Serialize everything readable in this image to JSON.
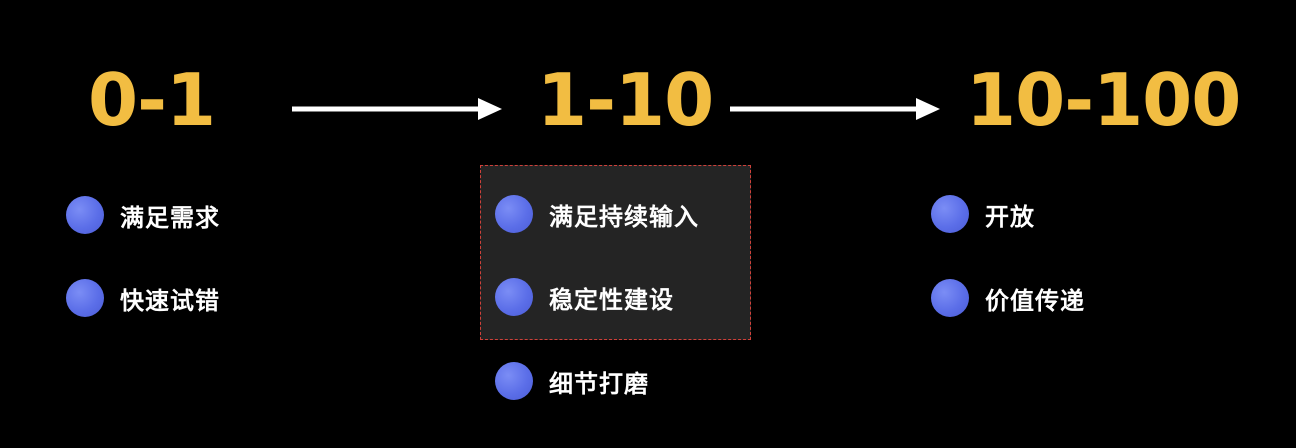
{
  "stages": [
    {
      "label": "0-1",
      "items": [
        "满足需求",
        "快速试错"
      ]
    },
    {
      "label": "1-10",
      "items": [
        "满足持续输入",
        "稳定性建设",
        "细节打磨"
      ]
    },
    {
      "label": "10-100",
      "items": [
        "开放",
        "价值传递"
      ]
    }
  ],
  "colors": {
    "background": "#000000",
    "stage_title": "#f2bd42",
    "bullet": "#5b6ee8",
    "highlight_border": "#d0413a",
    "highlight_fill": "#242424",
    "arrow": "#ffffff"
  }
}
